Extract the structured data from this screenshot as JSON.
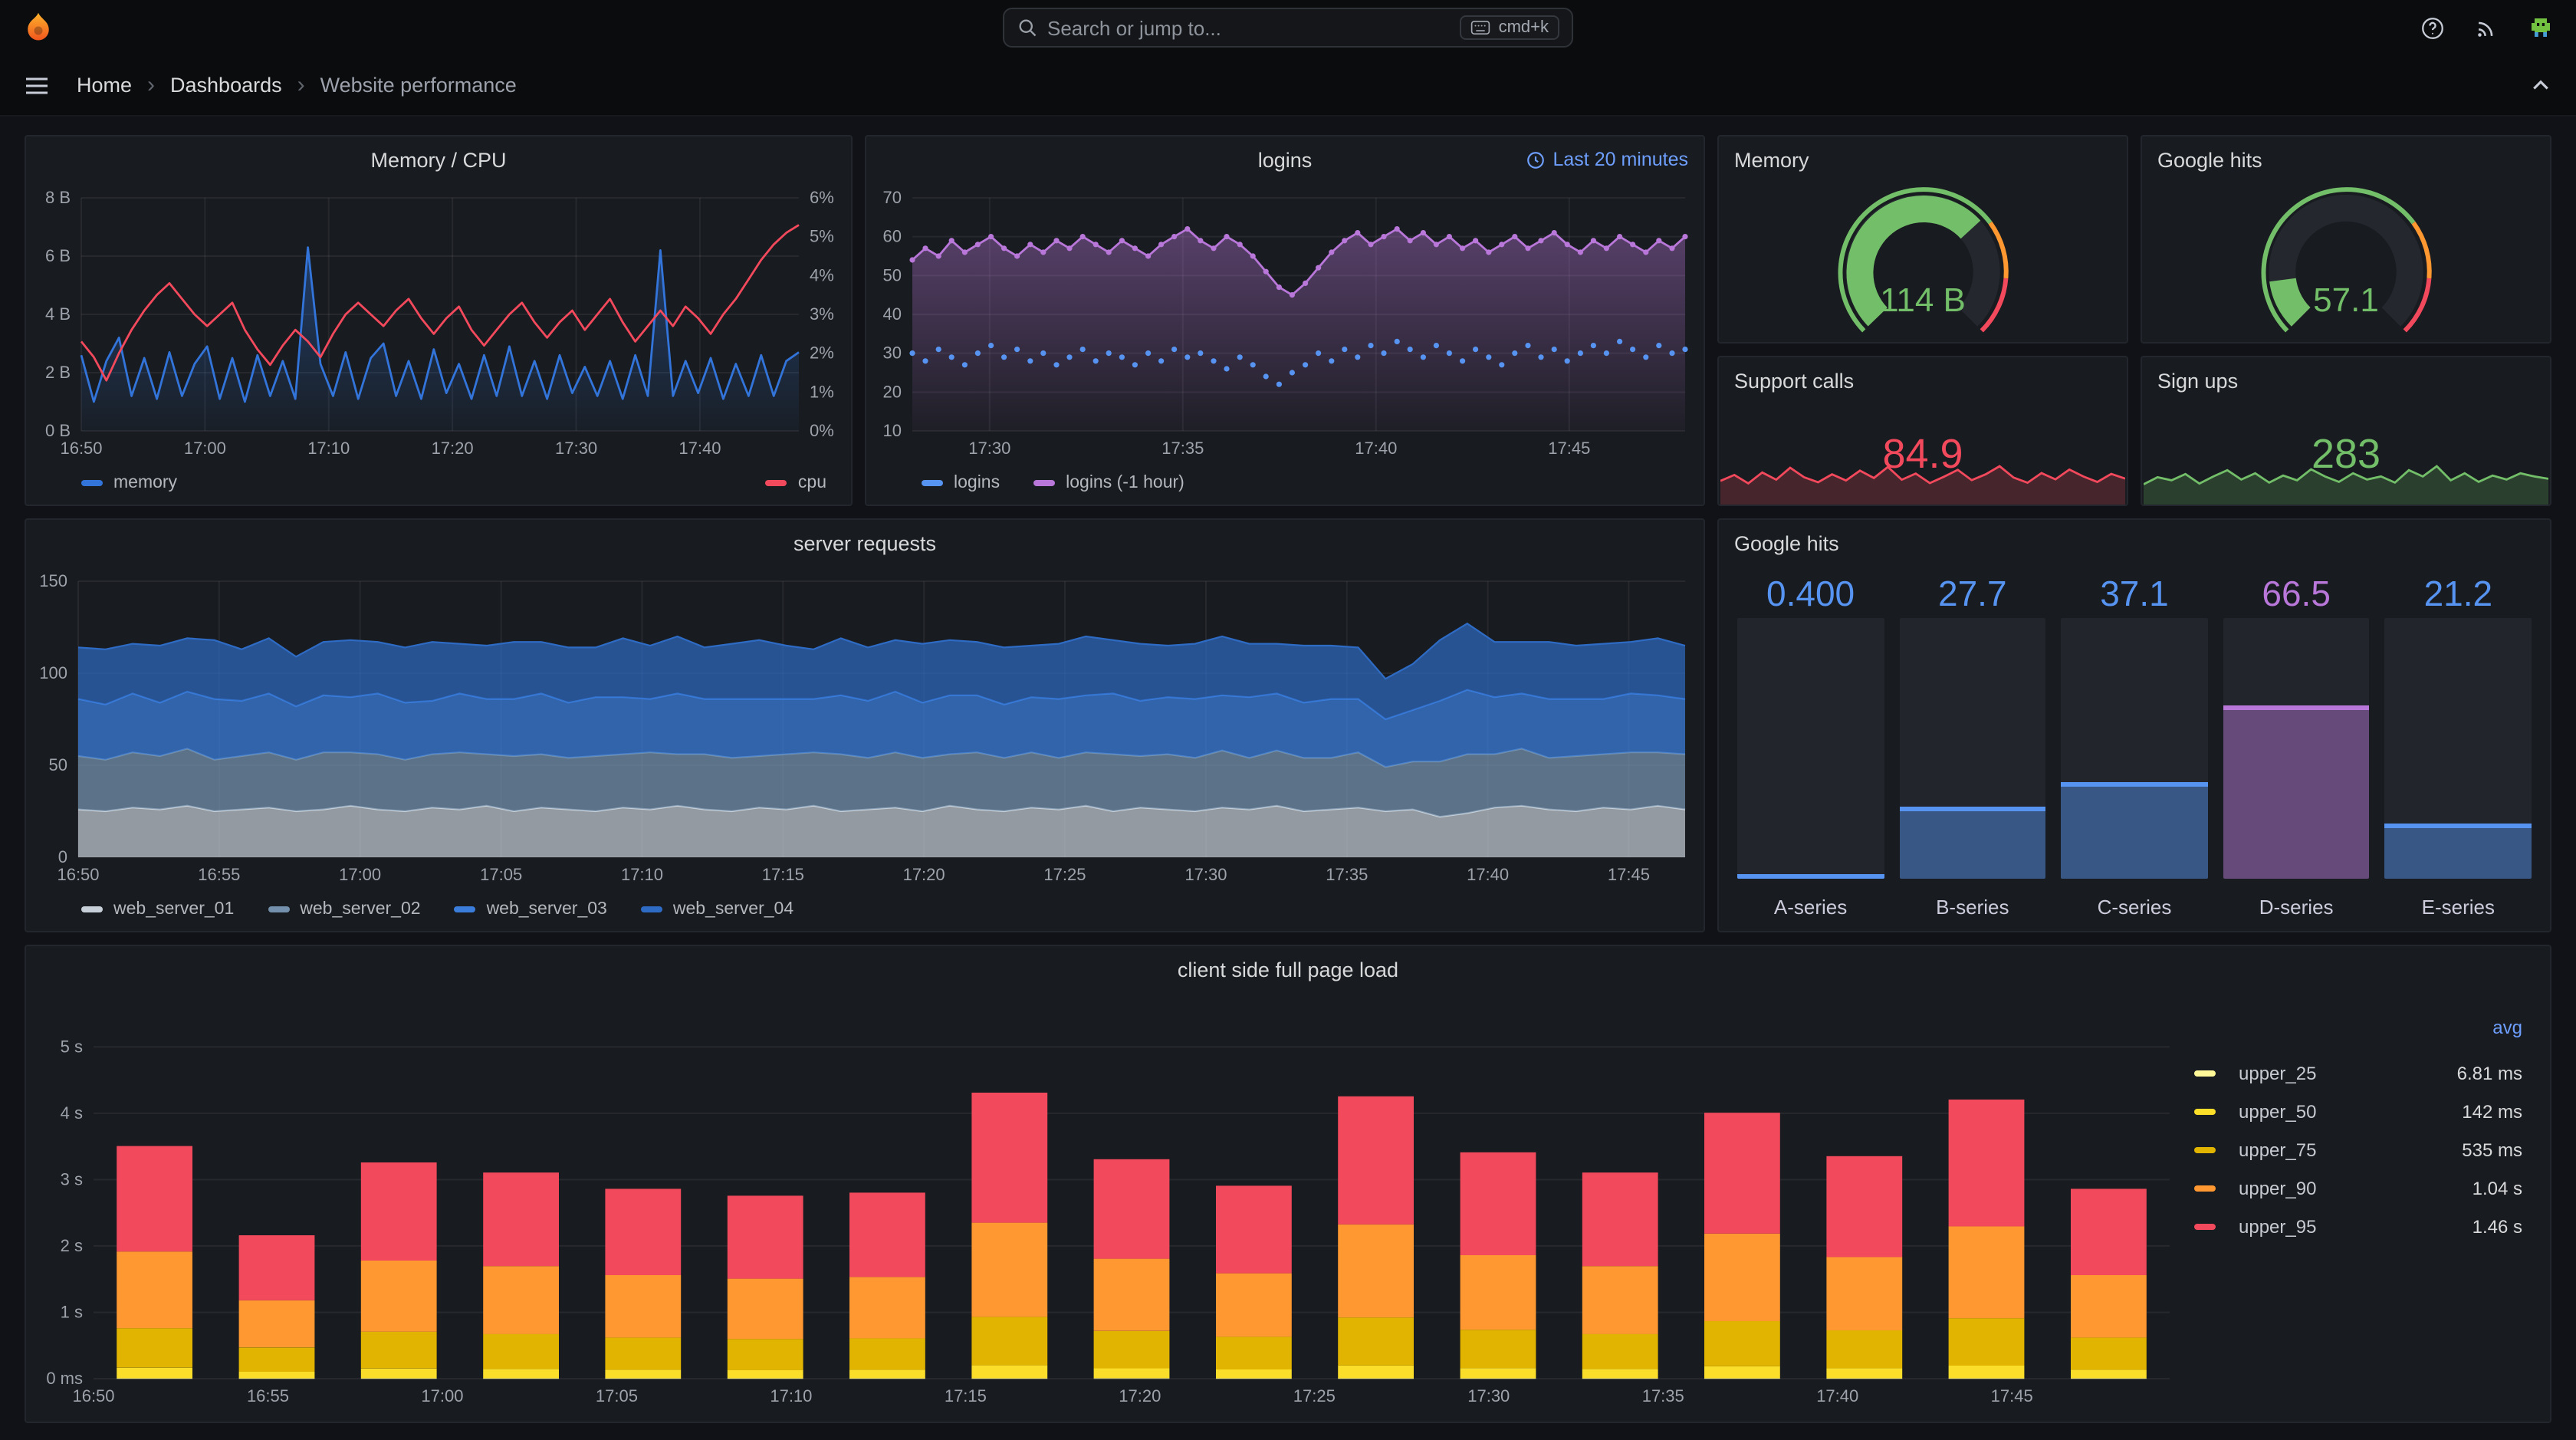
{
  "topnav": {
    "search_placeholder": "Search or jump to...",
    "shortcut_label": "cmd+k"
  },
  "breadcrumb": {
    "home": "Home",
    "dashboards": "Dashboards",
    "current": "Website performance"
  },
  "chart_data": [
    {
      "id": "memcpu",
      "type": "timeseries",
      "title": "Memory / CPU",
      "y_min": 0,
      "y_max": 8,
      "y_ticks": [
        {
          "v": 0,
          "l": "0 B"
        },
        {
          "v": 2,
          "l": "2 B"
        },
        {
          "v": 4,
          "l": "4 B"
        },
        {
          "v": 6,
          "l": "6 B"
        },
        {
          "v": 8,
          "l": "8 B"
        }
      ],
      "yr_min": 0,
      "yr_max": 6,
      "y_right_ticks": [
        {
          "v": 0,
          "l": "0%"
        },
        {
          "v": 1,
          "l": "1%"
        },
        {
          "v": 2,
          "l": "2%"
        },
        {
          "v": 3,
          "l": "3%"
        },
        {
          "v": 4,
          "l": "4%"
        },
        {
          "v": 5,
          "l": "5%"
        },
        {
          "v": 6,
          "l": "6%"
        }
      ],
      "x_ticks": [
        {
          "f": 0,
          "l": "16:50"
        },
        {
          "f": 0.1724,
          "l": "17:00"
        },
        {
          "f": 0.3448,
          "l": "17:10"
        },
        {
          "f": 0.5172,
          "l": "17:20"
        },
        {
          "f": 0.6897,
          "l": "17:30"
        },
        {
          "f": 0.8621,
          "l": "17:40"
        }
      ],
      "series": [
        {
          "name": "memory",
          "color": "#3274D9",
          "fill": true,
          "values": [
            2.6,
            1.0,
            2.4,
            3.2,
            1.2,
            2.5,
            1.1,
            2.7,
            1.2,
            2.3,
            2.9,
            1.1,
            2.5,
            1.0,
            2.6,
            1.2,
            2.4,
            1.1,
            6.3,
            2.3,
            1.2,
            2.7,
            1.1,
            2.5,
            3.0,
            1.2,
            2.4,
            1.1,
            2.8,
            1.3,
            2.3,
            1.1,
            2.6,
            1.2,
            2.9,
            1.2,
            2.4,
            1.1,
            2.6,
            1.3,
            2.2,
            1.2,
            2.4,
            1.1,
            2.6,
            1.2,
            6.2,
            1.2,
            2.4,
            1.3,
            2.5,
            1.1,
            2.3,
            1.2,
            2.6,
            1.2,
            2.4,
            2.7
          ]
        },
        {
          "name": "cpu",
          "color": "#F2495C",
          "axis": "right",
          "values": [
            2.3,
            1.9,
            1.3,
            2.0,
            2.6,
            3.1,
            3.5,
            3.8,
            3.4,
            3.0,
            2.7,
            3.0,
            3.3,
            2.6,
            2.1,
            1.7,
            2.2,
            2.6,
            2.3,
            1.9,
            2.5,
            3.0,
            3.3,
            3.0,
            2.7,
            3.1,
            3.4,
            2.9,
            2.5,
            2.9,
            3.2,
            2.6,
            2.2,
            2.6,
            3.0,
            3.3,
            2.8,
            2.4,
            2.8,
            3.1,
            2.6,
            3.0,
            3.4,
            2.8,
            2.3,
            2.7,
            3.1,
            2.7,
            3.2,
            2.9,
            2.5,
            3.0,
            3.4,
            3.9,
            4.4,
            4.8,
            5.1,
            5.3
          ]
        }
      ]
    },
    {
      "id": "logins",
      "type": "timeseries",
      "title": "logins",
      "time_label": "Last 20 minutes",
      "y_min": 10,
      "y_max": 70,
      "y_ticks": [
        {
          "v": 10,
          "l": "10"
        },
        {
          "v": 20,
          "l": "20"
        },
        {
          "v": 30,
          "l": "30"
        },
        {
          "v": 40,
          "l": "40"
        },
        {
          "v": 50,
          "l": "50"
        },
        {
          "v": 60,
          "l": "60"
        },
        {
          "v": 70,
          "l": "70"
        }
      ],
      "x_ticks": [
        {
          "f": 0.1,
          "l": "17:30"
        },
        {
          "f": 0.35,
          "l": "17:35"
        },
        {
          "f": 0.6,
          "l": "17:40"
        },
        {
          "f": 0.85,
          "l": "17:45"
        }
      ],
      "series": [
        {
          "name": "logins (-1 hour)",
          "color": "#B877D9",
          "fill": true,
          "points": true,
          "values": [
            54,
            57,
            55,
            59,
            56,
            58,
            60,
            57,
            55,
            58,
            56,
            59,
            57,
            60,
            58,
            56,
            59,
            57,
            55,
            58,
            60,
            62,
            59,
            57,
            60,
            58,
            55,
            51,
            47,
            45,
            48,
            52,
            56,
            59,
            61,
            58,
            60,
            62,
            59,
            61,
            58,
            60,
            57,
            59,
            56,
            58,
            60,
            57,
            59,
            61,
            58,
            56,
            59,
            57,
            60,
            58,
            56,
            59,
            57,
            60
          ]
        },
        {
          "name": "logins",
          "color": "#5794F2",
          "line": false,
          "points": true,
          "values": [
            30,
            28,
            31,
            29,
            27,
            30,
            32,
            29,
            31,
            28,
            30,
            27,
            29,
            31,
            28,
            30,
            29,
            27,
            30,
            28,
            31,
            29,
            30,
            28,
            26,
            29,
            27,
            24,
            22,
            25,
            27,
            30,
            28,
            31,
            29,
            32,
            30,
            33,
            31,
            29,
            32,
            30,
            28,
            31,
            29,
            27,
            30,
            32,
            29,
            31,
            28,
            30,
            32,
            30,
            33,
            31,
            29,
            32,
            30,
            31
          ]
        }
      ]
    },
    {
      "id": "memgauge",
      "type": "gauge",
      "title": "Memory",
      "value": "114 B",
      "percent": 0.68,
      "color": "#73BF69",
      "thresholds": [
        {
          "from": 0,
          "to": 0.7,
          "color": "#73BF69"
        },
        {
          "from": 0.7,
          "to": 0.85,
          "color": "#FF9830"
        },
        {
          "from": 0.85,
          "to": 1,
          "color": "#F2495C"
        }
      ]
    },
    {
      "id": "googlegauge",
      "type": "gauge",
      "title": "Google hits",
      "value": "57.1",
      "percent": 0.14,
      "color": "#73BF69",
      "thresholds": [
        {
          "from": 0,
          "to": 0.7,
          "color": "#73BF69"
        },
        {
          "from": 0.7,
          "to": 0.85,
          "color": "#FF9830"
        },
        {
          "from": 0.85,
          "to": 1,
          "color": "#F2495C"
        }
      ]
    },
    {
      "id": "support",
      "type": "sparkline",
      "title": "Support calls",
      "value": "84.9",
      "color": "#F2495C",
      "values": [
        52,
        68,
        45,
        75,
        55,
        88,
        62,
        48,
        70,
        53,
        80,
        60,
        90,
        55,
        72,
        46,
        63,
        82,
        54,
        70,
        92,
        61,
        47,
        73,
        56,
        83,
        64,
        49,
        71,
        58
      ]
    },
    {
      "id": "signups",
      "type": "sparkline",
      "title": "Sign ups",
      "value": "283",
      "color": "#73BF69",
      "values": [
        40,
        58,
        50,
        66,
        42,
        60,
        76,
        52,
        68,
        44,
        62,
        50,
        78,
        60,
        46,
        68,
        52,
        60,
        44,
        76,
        60,
        86,
        50,
        68,
        46,
        62,
        52,
        68,
        60,
        54
      ]
    },
    {
      "id": "requests",
      "type": "stacked-area",
      "title": "server requests",
      "y_min": 0,
      "y_max": 150,
      "y_ticks": [
        {
          "v": 0,
          "l": "0"
        },
        {
          "v": 50,
          "l": "50"
        },
        {
          "v": 100,
          "l": "100"
        },
        {
          "v": 150,
          "l": "150"
        }
      ],
      "x_ticks": [
        {
          "f": 0,
          "l": "16:50"
        },
        {
          "f": 0.0877,
          "l": "16:55"
        },
        {
          "f": 0.1754,
          "l": "17:00"
        },
        {
          "f": 0.2632,
          "l": "17:05"
        },
        {
          "f": 0.3509,
          "l": "17:10"
        },
        {
          "f": 0.4386,
          "l": "17:15"
        },
        {
          "f": 0.5263,
          "l": "17:20"
        },
        {
          "f": 0.614,
          "l": "17:25"
        },
        {
          "f": 0.7018,
          "l": "17:30"
        },
        {
          "f": 0.7895,
          "l": "17:35"
        },
        {
          "f": 0.8772,
          "l": "17:40"
        },
        {
          "f": 0.9649,
          "l": "17:45"
        }
      ],
      "series": [
        {
          "name": "web_server_01",
          "color": "#C7D0D9",
          "fillOpacity": 0.7,
          "values": [
            26,
            25,
            27,
            26,
            28,
            25,
            26,
            27,
            25,
            26,
            28,
            26,
            25,
            27,
            26,
            28,
            25,
            27,
            26,
            25,
            27,
            26,
            28,
            26,
            25,
            27,
            26,
            28,
            25,
            26,
            27,
            25,
            28,
            26,
            25,
            27,
            26,
            28,
            25,
            27,
            26,
            25,
            27,
            26,
            28,
            25,
            26,
            27,
            25,
            26,
            22,
            24,
            27,
            28,
            26,
            25,
            27,
            26,
            28,
            26
          ]
        },
        {
          "name": "web_server_02",
          "color": "#7390AC",
          "fillOpacity": 0.75,
          "values": [
            29,
            28,
            30,
            29,
            31,
            28,
            29,
            30,
            28,
            31,
            29,
            30,
            28,
            29,
            31,
            28,
            30,
            29,
            28,
            30,
            29,
            31,
            28,
            30,
            29,
            28,
            30,
            29,
            31,
            28,
            30,
            29,
            28,
            31,
            29,
            30,
            28,
            29,
            31,
            28,
            30,
            29,
            31,
            28,
            30,
            29,
            28,
            30,
            24,
            26,
            30,
            32,
            29,
            31,
            28,
            30,
            29,
            31,
            29,
            30
          ]
        },
        {
          "name": "web_server_03",
          "color": "#3B7DDB",
          "fillOpacity": 0.75,
          "values": [
            31,
            30,
            32,
            29,
            31,
            33,
            30,
            32,
            29,
            31,
            30,
            33,
            31,
            29,
            32,
            30,
            31,
            33,
            30,
            32,
            31,
            29,
            33,
            30,
            32,
            31,
            30,
            29,
            32,
            31,
            33,
            30,
            32,
            31,
            29,
            30,
            32,
            31,
            33,
            30,
            31,
            32,
            30,
            33,
            31,
            30,
            32,
            29,
            26,
            28,
            33,
            35,
            31,
            30,
            32,
            31,
            30,
            32,
            31,
            30
          ]
        },
        {
          "name": "web_server_04",
          "color": "#2E6BC4",
          "fillOpacity": 0.7,
          "values": [
            28,
            30,
            27,
            31,
            29,
            32,
            28,
            30,
            27,
            29,
            31,
            28,
            30,
            32,
            27,
            29,
            31,
            28,
            30,
            27,
            32,
            29,
            31,
            28,
            30,
            32,
            29,
            27,
            31,
            29,
            28,
            32,
            30,
            29,
            31,
            28,
            30,
            32,
            29,
            31,
            28,
            30,
            32,
            29,
            27,
            31,
            29,
            28,
            22,
            25,
            33,
            36,
            30,
            28,
            31,
            29,
            30,
            28,
            31,
            29
          ]
        }
      ]
    },
    {
      "id": "bargauge",
      "type": "bar-gauge",
      "title": "Google hits",
      "bars": [
        {
          "label": "A-series",
          "value": "0.400",
          "pct": 0.004,
          "color": "#5794F2"
        },
        {
          "label": "B-series",
          "value": "27.7",
          "pct": 0.277,
          "color": "#5794F2"
        },
        {
          "label": "C-series",
          "value": "37.1",
          "pct": 0.371,
          "color": "#5794F2"
        },
        {
          "label": "D-series",
          "value": "66.5",
          "pct": 0.665,
          "color": "#B877D9"
        },
        {
          "label": "E-series",
          "value": "21.2",
          "pct": 0.212,
          "color": "#5794F2"
        }
      ]
    },
    {
      "id": "clientload",
      "type": "stacked-bar",
      "title": "client side full page load",
      "legend_header": "avg",
      "x_grid": false,
      "y_min": 0,
      "y_max": 5.5,
      "y_ticks": [
        {
          "v": 0,
          "l": "0 ms"
        },
        {
          "v": 1,
          "l": "1 s"
        },
        {
          "v": 2,
          "l": "2 s"
        },
        {
          "v": 3,
          "l": "3 s"
        },
        {
          "v": 4,
          "l": "4 s"
        },
        {
          "v": 5,
          "l": "5 s"
        }
      ],
      "x_ticks": [
        {
          "f": 0,
          "l": "16:50"
        },
        {
          "f": 0.084,
          "l": "16:55"
        },
        {
          "f": 0.168,
          "l": "17:00"
        },
        {
          "f": 0.252,
          "l": "17:05"
        },
        {
          "f": 0.336,
          "l": "17:10"
        },
        {
          "f": 0.42,
          "l": "17:15"
        },
        {
          "f": 0.504,
          "l": "17:20"
        },
        {
          "f": 0.588,
          "l": "17:25"
        },
        {
          "f": 0.672,
          "l": "17:30"
        },
        {
          "f": 0.756,
          "l": "17:35"
        },
        {
          "f": 0.84,
          "l": "17:40"
        },
        {
          "f": 0.924,
          "l": "17:45"
        }
      ],
      "series": [
        {
          "name": "upper_25",
          "avg": "6.81 ms",
          "color": "#FFF899"
        },
        {
          "name": "upper_50",
          "avg": "142 ms",
          "color": "#FADE2A"
        },
        {
          "name": "upper_75",
          "avg": "535 ms",
          "color": "#E0B400"
        },
        {
          "name": "upper_90",
          "avg": "1.04 s",
          "color": "#FF9830"
        },
        {
          "name": "upper_95",
          "avg": "1.46 s",
          "color": "#F2495C"
        }
      ],
      "bars": [
        [
          0.007,
          0.158,
          0.595,
          1.155,
          1.59
        ],
        [
          0.007,
          0.097,
          0.366,
          0.71,
          0.98
        ],
        [
          0.007,
          0.146,
          0.553,
          1.073,
          1.48
        ],
        [
          0.007,
          0.14,
          0.527,
          1.023,
          1.41
        ],
        [
          0.007,
          0.128,
          0.485,
          0.94,
          1.3
        ],
        [
          0.007,
          0.124,
          0.468,
          0.908,
          1.25
        ],
        [
          0.007,
          0.126,
          0.476,
          0.924,
          1.27
        ],
        [
          0.007,
          0.194,
          0.731,
          1.419,
          1.96
        ],
        [
          0.007,
          0.149,
          0.561,
          1.089,
          1.5
        ],
        [
          0.007,
          0.131,
          0.493,
          0.957,
          1.32
        ],
        [
          0.007,
          0.191,
          0.723,
          1.403,
          1.93
        ],
        [
          0.007,
          0.153,
          0.578,
          1.122,
          1.55
        ],
        [
          0.007,
          0.14,
          0.527,
          1.023,
          1.41
        ],
        [
          0.007,
          0.18,
          0.68,
          1.32,
          1.82
        ],
        [
          0.007,
          0.151,
          0.57,
          1.106,
          1.52
        ],
        [
          0.007,
          0.189,
          0.714,
          1.386,
          1.91
        ],
        [
          0.007,
          0.128,
          0.485,
          0.94,
          1.3
        ]
      ]
    }
  ]
}
